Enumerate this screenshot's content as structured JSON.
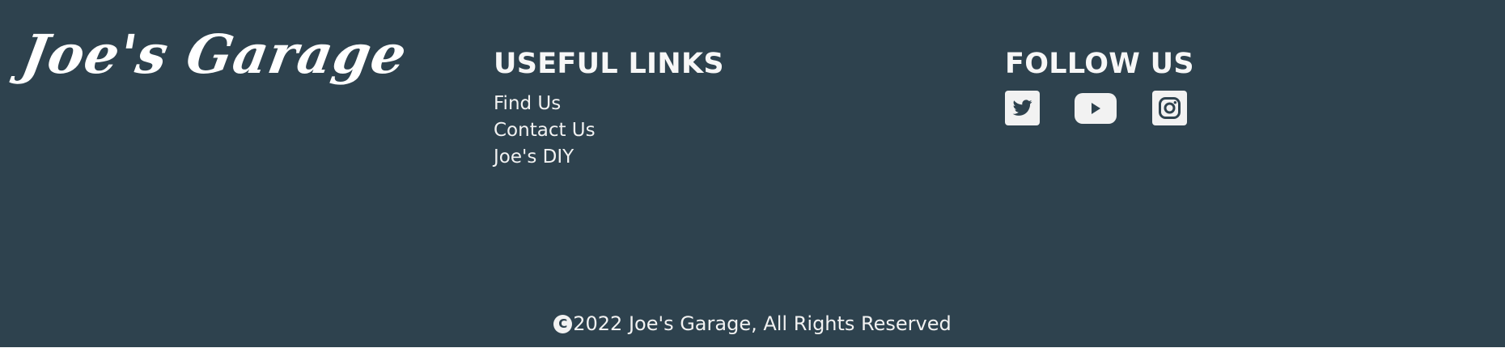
{
  "brand": {
    "logo_text": "Joe's Garage"
  },
  "useful_links": {
    "title": "USEFUL LINKS",
    "items": [
      {
        "label": "Find Us"
      },
      {
        "label": "Contact Us"
      },
      {
        "label": "Joe's DIY"
      }
    ]
  },
  "follow_us": {
    "title": "FOLLOW US",
    "icons": [
      "twitter-icon",
      "youtube-icon",
      "instagram-icon"
    ]
  },
  "copyright": {
    "symbol": "C",
    "text": "2022 Joe's Garage, All Rights Reserved"
  },
  "colors": {
    "background": "#2e424e",
    "text": "#f2f2f2"
  }
}
